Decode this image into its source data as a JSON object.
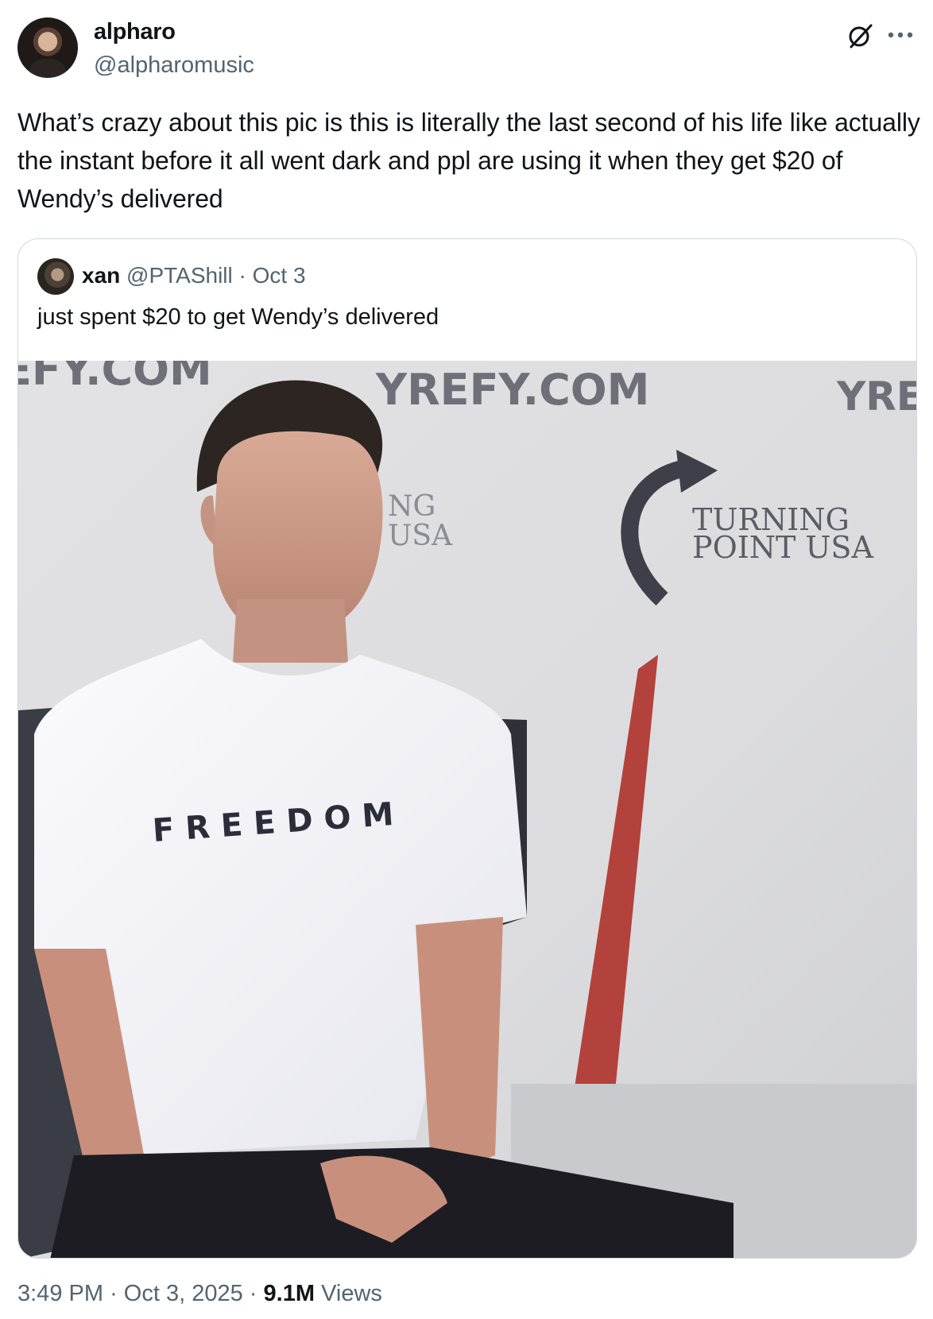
{
  "author": {
    "display_name": "alpharo",
    "handle": "@alpharomusic"
  },
  "tweet": {
    "text": "What’s crazy about this pic is this is literally the last second of his life like actually the instant before it all went dark and ppl are using it when they get $20 of Wendy’s delivered"
  },
  "icons": {
    "grok": "grok-icon",
    "more": "more-icon"
  },
  "quoted_tweet": {
    "display_name": "xan",
    "handle": "@PTAShill",
    "separator": "·",
    "date": "Oct 3",
    "text": "just spent $20 to get Wendy’s delivered",
    "image": {
      "banner_text_left": "EFY.COM",
      "banner_text_center": "YREFY.COM",
      "banner_text_right": "YRE",
      "logo_text_line1": "TURNING",
      "logo_text_line2": "POINT USA",
      "partial_logo_line1": "NG",
      "partial_logo_line2": "USA",
      "shirt_text": "FREEDOM"
    }
  },
  "footer": {
    "time": "3:49 PM",
    "sep1": "·",
    "date": "Oct 3, 2025",
    "sep2": "·",
    "views_count": "9.1M",
    "views_label": "Views"
  },
  "colors": {
    "text": "#0f1419",
    "muted": "#536471",
    "border": "#cfd9de"
  }
}
